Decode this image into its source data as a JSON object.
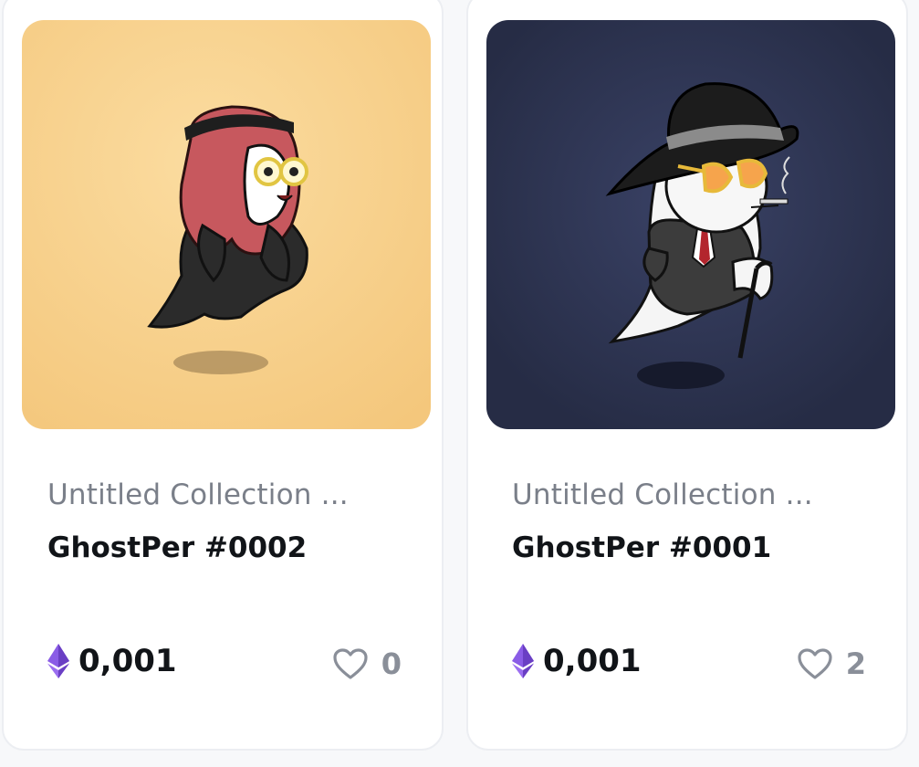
{
  "cards": [
    {
      "collection": "Untitled Collection ...",
      "title": "GhostPer #0002",
      "price": "0,001",
      "currency_icon": "ethereum-icon",
      "likes": "0",
      "image_background": "#f5c77e"
    },
    {
      "collection": "Untitled Collection ...",
      "title": "GhostPer #0001",
      "price": "0,001",
      "currency_icon": "ethereum-icon",
      "likes": "2",
      "image_background": "#2b3350"
    }
  ],
  "colors": {
    "ethereum": "#7b4fd6",
    "heart_outline": "#8a8f99"
  }
}
